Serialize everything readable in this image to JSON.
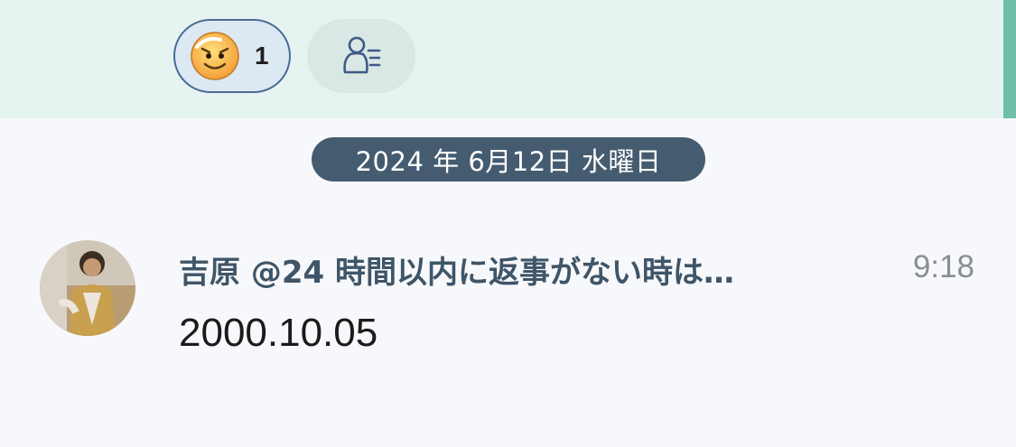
{
  "reactions": {
    "emoji_icon": "smiling-face-icon",
    "count": "1",
    "add_icon": "add-reaction-person-icon"
  },
  "date_divider": "2024 年 6月12日 水曜日",
  "message": {
    "sender": "吉原 @24 時間以内に返事がない時は…",
    "time": "9:18",
    "text": "2000.10.05"
  },
  "colors": {
    "strip_bg": "#e5f4f1",
    "accent_bar": "#6fbfaa",
    "pill_bg": "#455c70",
    "sender": "#3f5568",
    "time": "#8a8d91"
  }
}
